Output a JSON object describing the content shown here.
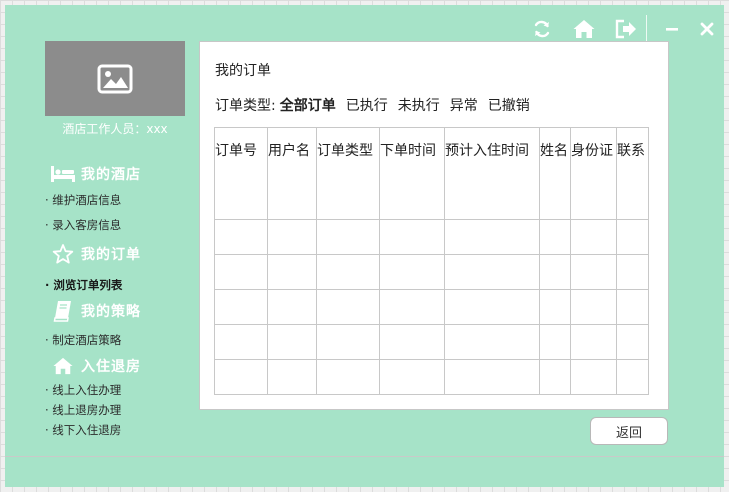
{
  "sidebar": {
    "staff_label": "酒店工作人员：xxx",
    "sections": [
      {
        "title": "我的酒店",
        "icon": "bed-icon",
        "items": [
          {
            "label": "· 维护酒店信息",
            "active": false
          },
          {
            "label": "· 录入客房信息",
            "active": false
          }
        ]
      },
      {
        "title": "我的订单",
        "icon": "star-icon",
        "items": [
          {
            "label": "· 浏览订单列表",
            "active": true
          }
        ]
      },
      {
        "title": "我的策略",
        "icon": "book-icon",
        "items": [
          {
            "label": "· 制定酒店策略",
            "active": false
          }
        ]
      },
      {
        "title": "入住退房",
        "icon": "home-icon",
        "items": [
          {
            "label": "· 线上入住办理",
            "active": false
          },
          {
            "label": "· 线上退房办理",
            "active": false
          },
          {
            "label": "· 线下入住退房",
            "active": false
          }
        ]
      }
    ]
  },
  "main": {
    "title": "我的订单",
    "filter_label": "订单类型:",
    "filter_options": [
      "全部订单",
      "已执行",
      "未执行",
      "异常",
      "已撤销"
    ],
    "selected_filter": "全部订单",
    "table": {
      "columns": [
        "订单号",
        "用户名",
        "订单类型",
        "下单时间",
        "预计入住时间",
        "姓名",
        "身份证",
        "联系"
      ],
      "rows": [
        [
          "",
          "",
          "",
          "",
          "",
          "",
          "",
          ""
        ],
        [
          "",
          "",
          "",
          "",
          "",
          "",
          "",
          ""
        ],
        [
          "",
          "",
          "",
          "",
          "",
          "",
          "",
          ""
        ],
        [
          "",
          "",
          "",
          "",
          "",
          "",
          "",
          ""
        ],
        [
          "",
          "",
          "",
          "",
          "",
          "",
          "",
          ""
        ]
      ]
    },
    "back_label": "返回"
  },
  "titlebar": {
    "icons": [
      "refresh-icon",
      "home-icon",
      "logout-icon",
      "minimize-icon",
      "close-icon"
    ]
  },
  "colors": {
    "window_bg": "#a6e3c8",
    "photo_bg": "#8c8c8c"
  }
}
